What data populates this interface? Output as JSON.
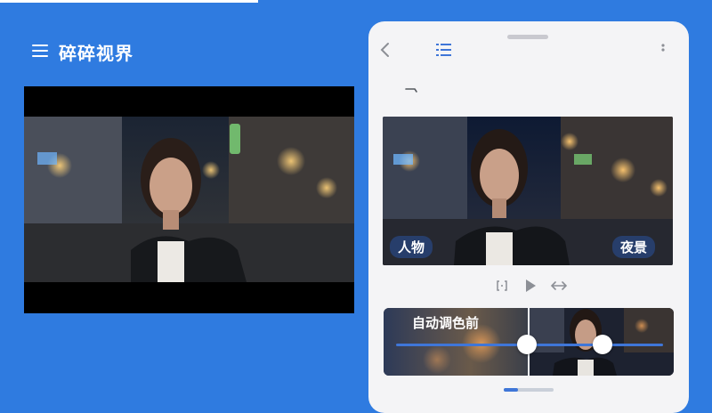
{
  "app": {
    "title": "碎碎视界"
  },
  "icons": {
    "menu": "hamburger-menu-icon",
    "back": "chevron-left-icon",
    "list": "list-icon",
    "more": "more-vertical-icon",
    "crop": "crop-corner-icon",
    "compare": "compare-icon",
    "play": "play-icon",
    "fit": "horizontal-arrows-icon"
  },
  "preview": {
    "tags": {
      "person": "人物",
      "scene": "夜景"
    }
  },
  "compare": {
    "label": "自动调色前",
    "slider_value": 0.6
  },
  "colors": {
    "accent": "#3f76d8",
    "background": "#2f7be0"
  }
}
